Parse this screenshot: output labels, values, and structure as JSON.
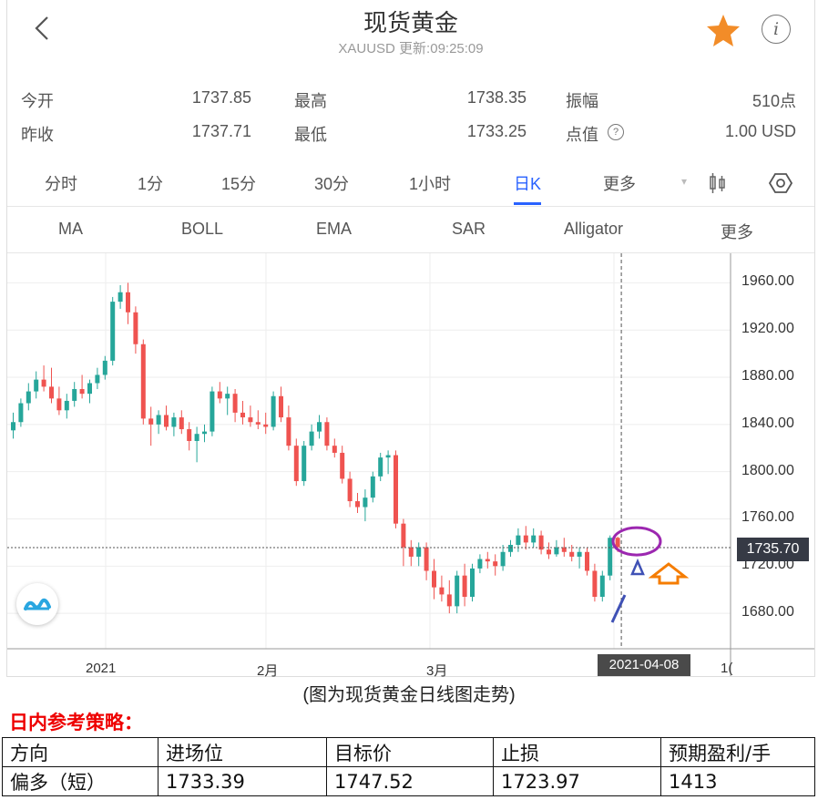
{
  "header": {
    "title": "现货黄金",
    "subtitle": "XAUUSD 更新:09:25:09",
    "back_icon": "chevron-left-icon",
    "favorite_icon": "star-icon",
    "info_icon": "info-icon",
    "star_color": "#f28c28"
  },
  "quote": {
    "open_label": "今开",
    "open_value": "1737.85",
    "high_label": "最高",
    "high_value": "1738.35",
    "range_label": "振幅",
    "range_value": "510点",
    "prev_close_label": "昨收",
    "prev_close_value": "1737.71",
    "low_label": "最低",
    "low_value": "1733.25",
    "point_label": "点值",
    "point_value": "1.00 USD"
  },
  "timeframes": [
    "分时",
    "1分",
    "15分",
    "30分",
    "1小时",
    "日K",
    "更多"
  ],
  "active_timeframe": "日K",
  "indicators": [
    "MA",
    "BOLL",
    "EMA",
    "SAR",
    "Alligator",
    "更多"
  ],
  "chart": {
    "price_tag": "1735.70",
    "date_tag": "2021-04-08",
    "up_color": "#26a69a",
    "down_color": "#ef5350",
    "x_extra": "1(",
    "logo_icon": "wave-logo-icon",
    "annotation_colors": {
      "circle": "#9c27b0",
      "arrow": "#f57c00",
      "line": "#3f51b5"
    }
  },
  "chart_data": {
    "type": "candlestick",
    "title": "",
    "ylim": [
      1650,
      1985
    ],
    "y_ticks": [
      "1960.00",
      "1920.00",
      "1880.00",
      "1840.00",
      "1800.00",
      "1760.00",
      "1720.00",
      "1680.00"
    ],
    "x_ticks": [
      "2021",
      "2月",
      "3月"
    ],
    "current_price": 1735.7,
    "ohlc": [
      [
        1835,
        1850,
        1828,
        1842
      ],
      [
        1842,
        1862,
        1838,
        1858
      ],
      [
        1858,
        1875,
        1852,
        1868
      ],
      [
        1868,
        1885,
        1862,
        1878
      ],
      [
        1878,
        1890,
        1868,
        1872
      ],
      [
        1872,
        1888,
        1858,
        1862
      ],
      [
        1862,
        1872,
        1848,
        1852
      ],
      [
        1852,
        1866,
        1845,
        1860
      ],
      [
        1860,
        1876,
        1855,
        1870
      ],
      [
        1870,
        1882,
        1862,
        1866
      ],
      [
        1866,
        1878,
        1858,
        1875
      ],
      [
        1875,
        1888,
        1870,
        1882
      ],
      [
        1882,
        1898,
        1878,
        1894
      ],
      [
        1894,
        1948,
        1890,
        1944
      ],
      [
        1944,
        1958,
        1938,
        1952
      ],
      [
        1952,
        1960,
        1925,
        1935
      ],
      [
        1935,
        1940,
        1900,
        1908
      ],
      [
        1908,
        1912,
        1840,
        1845
      ],
      [
        1845,
        1855,
        1822,
        1840
      ],
      [
        1840,
        1852,
        1832,
        1848
      ],
      [
        1848,
        1856,
        1835,
        1838
      ],
      [
        1838,
        1850,
        1830,
        1846
      ],
      [
        1846,
        1852,
        1832,
        1836
      ],
      [
        1836,
        1842,
        1818,
        1826
      ],
      [
        1826,
        1838,
        1808,
        1832
      ],
      [
        1832,
        1840,
        1825,
        1834
      ],
      [
        1834,
        1872,
        1830,
        1868
      ],
      [
        1868,
        1876,
        1858,
        1862
      ],
      [
        1862,
        1872,
        1848,
        1866
      ],
      [
        1866,
        1870,
        1842,
        1850
      ],
      [
        1850,
        1860,
        1840,
        1846
      ],
      [
        1846,
        1856,
        1838,
        1842
      ],
      [
        1842,
        1852,
        1836,
        1840
      ],
      [
        1840,
        1850,
        1832,
        1838
      ],
      [
        1838,
        1868,
        1835,
        1864
      ],
      [
        1864,
        1872,
        1842,
        1846
      ],
      [
        1846,
        1856,
        1818,
        1822
      ],
      [
        1822,
        1828,
        1788,
        1792
      ],
      [
        1792,
        1826,
        1788,
        1822
      ],
      [
        1822,
        1840,
        1818,
        1834
      ],
      [
        1834,
        1848,
        1828,
        1842
      ],
      [
        1842,
        1846,
        1818,
        1822
      ],
      [
        1822,
        1828,
        1812,
        1816
      ],
      [
        1816,
        1822,
        1790,
        1794
      ],
      [
        1794,
        1800,
        1770,
        1775
      ],
      [
        1775,
        1782,
        1765,
        1770
      ],
      [
        1770,
        1785,
        1758,
        1778
      ],
      [
        1778,
        1800,
        1774,
        1796
      ],
      [
        1796,
        1816,
        1792,
        1812
      ],
      [
        1812,
        1818,
        1798,
        1814
      ],
      [
        1814,
        1818,
        1752,
        1756
      ],
      [
        1756,
        1760,
        1720,
        1736
      ],
      [
        1736,
        1742,
        1720,
        1728
      ],
      [
        1728,
        1740,
        1720,
        1736
      ],
      [
        1736,
        1740,
        1708,
        1716
      ],
      [
        1716,
        1726,
        1692,
        1702
      ],
      [
        1702,
        1712,
        1690,
        1696
      ],
      [
        1696,
        1708,
        1680,
        1686
      ],
      [
        1686,
        1716,
        1680,
        1712
      ],
      [
        1712,
        1722,
        1686,
        1694
      ],
      [
        1694,
        1722,
        1690,
        1718
      ],
      [
        1718,
        1730,
        1714,
        1726
      ],
      [
        1726,
        1732,
        1718,
        1724
      ],
      [
        1724,
        1730,
        1712,
        1720
      ],
      [
        1720,
        1738,
        1716,
        1732
      ],
      [
        1732,
        1742,
        1728,
        1738
      ],
      [
        1738,
        1752,
        1732,
        1746
      ],
      [
        1746,
        1754,
        1734,
        1740
      ],
      [
        1740,
        1752,
        1736,
        1746
      ],
      [
        1746,
        1750,
        1730,
        1734
      ],
      [
        1734,
        1740,
        1726,
        1730
      ],
      [
        1730,
        1742,
        1728,
        1736
      ],
      [
        1736,
        1744,
        1728,
        1732
      ],
      [
        1732,
        1738,
        1724,
        1728
      ],
      [
        1728,
        1736,
        1718,
        1732
      ],
      [
        1732,
        1736,
        1712,
        1716
      ],
      [
        1716,
        1722,
        1690,
        1694
      ],
      [
        1694,
        1716,
        1690,
        1712
      ],
      [
        1712,
        1746,
        1708,
        1744
      ],
      [
        1744,
        1745,
        1732,
        1736
      ]
    ]
  },
  "caption": "(图为现货黄金日线图走势)",
  "strategy": {
    "title": "日内参考策略：",
    "headers": [
      "方向",
      "进场位",
      "目标价",
      "止损",
      "预期盈利/手"
    ],
    "row": [
      "偏多（短）",
      "1733.39",
      "1747.52",
      "1723.97",
      "1413"
    ]
  }
}
